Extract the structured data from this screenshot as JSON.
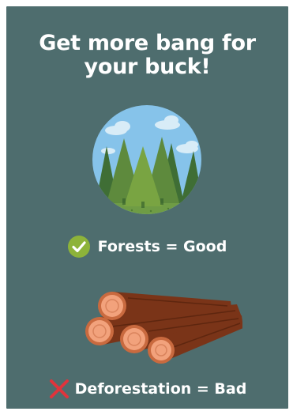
{
  "title": {
    "line1": "Get more bang for",
    "line2": "your buck!"
  },
  "good": {
    "label": "Forests = Good",
    "icon": "check-circle-icon",
    "color": "#8db33a"
  },
  "bad": {
    "label": "Deforestation = Bad",
    "icon": "cross-icon",
    "color": "#e0343c"
  },
  "colors": {
    "background": "#4e6d6e",
    "sky": "#86c3ea",
    "tree_dark": "#3f6e35",
    "tree_mid": "#5e8a3d",
    "tree_light": "#79a442",
    "log_bark": "#7a3418",
    "log_end": "#f2a27c"
  }
}
